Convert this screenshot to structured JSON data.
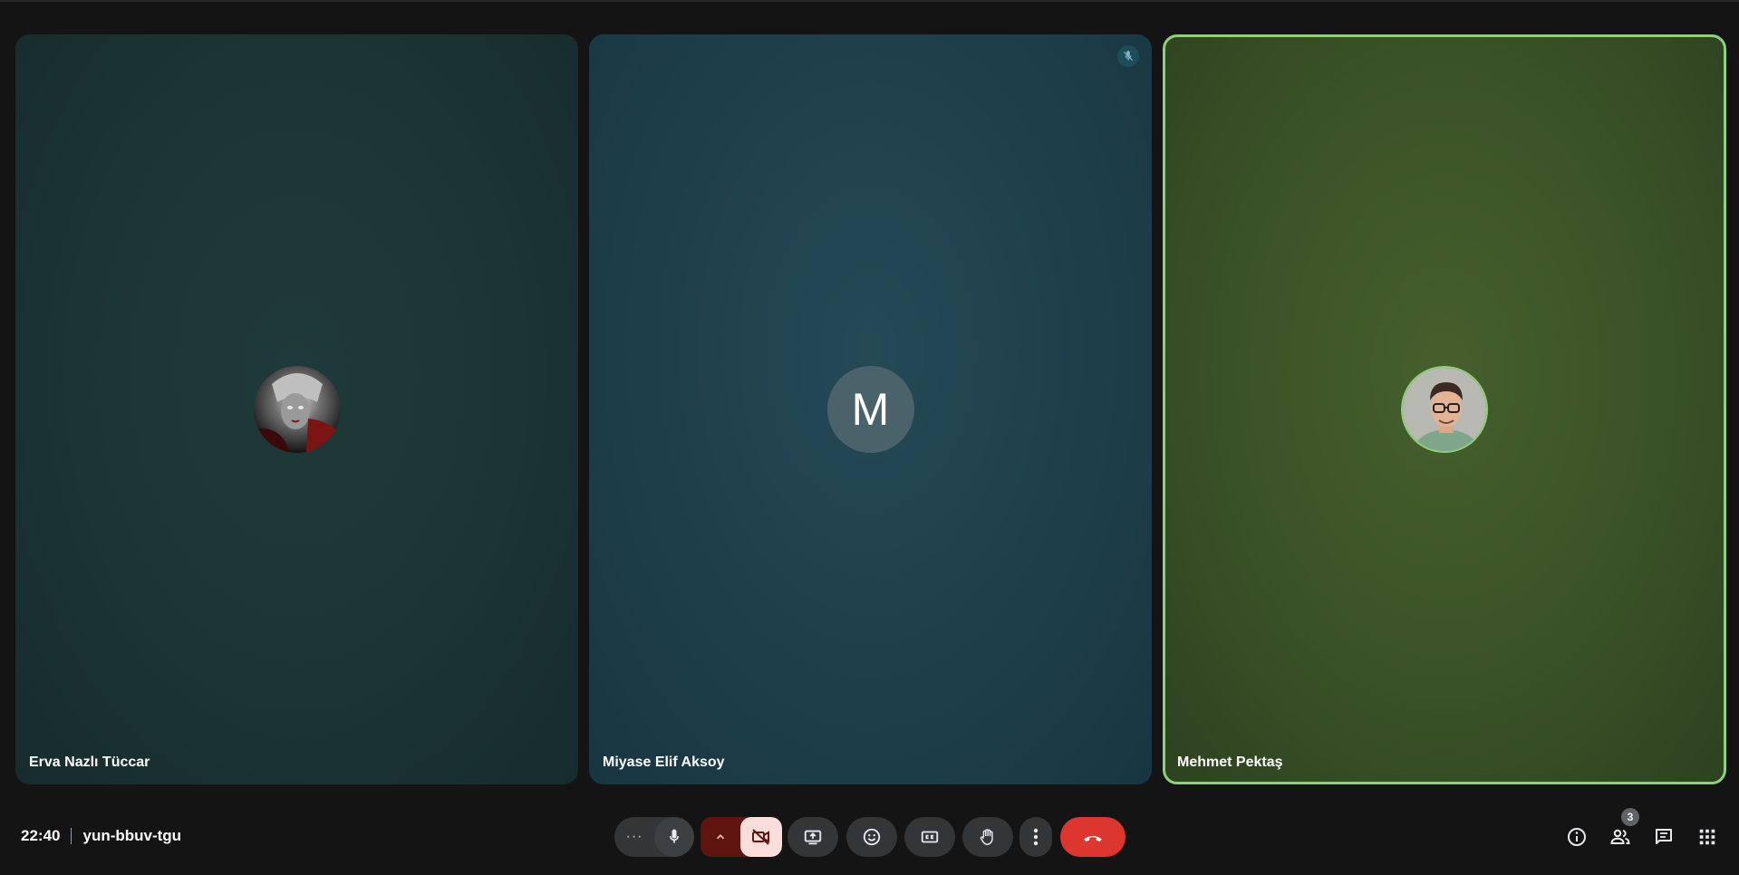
{
  "participants": [
    {
      "name": "Erva Nazlı Tüccar",
      "avatar": "photo-avatar-dark-art",
      "muted": false
    },
    {
      "name": "Miyase Elif Aksoy",
      "initial": "M",
      "muted": true
    },
    {
      "name": "Mehmet Pektaş",
      "avatar": "photo-avatar-man-glasses",
      "active_speaker": true
    }
  ],
  "meeting": {
    "time": "22:40",
    "code": "yun-bbuv-tgu"
  },
  "controls": {
    "more_audio": "···",
    "mic": "microphone-icon",
    "camera": "camera-off-icon",
    "present": "present-screen-icon",
    "emoji": "emoji-icon",
    "captions": "captions-icon",
    "hand": "raise-hand-icon",
    "more": "more-vert-icon",
    "leave": "hang-up-icon"
  },
  "side_controls": {
    "people_count": "3"
  },
  "colors": {
    "active_speaker_border": "#8fd17a",
    "leave": "#dc362e",
    "camera_off_bg": "#f9dedc",
    "camera_off_dark": "#601410"
  }
}
